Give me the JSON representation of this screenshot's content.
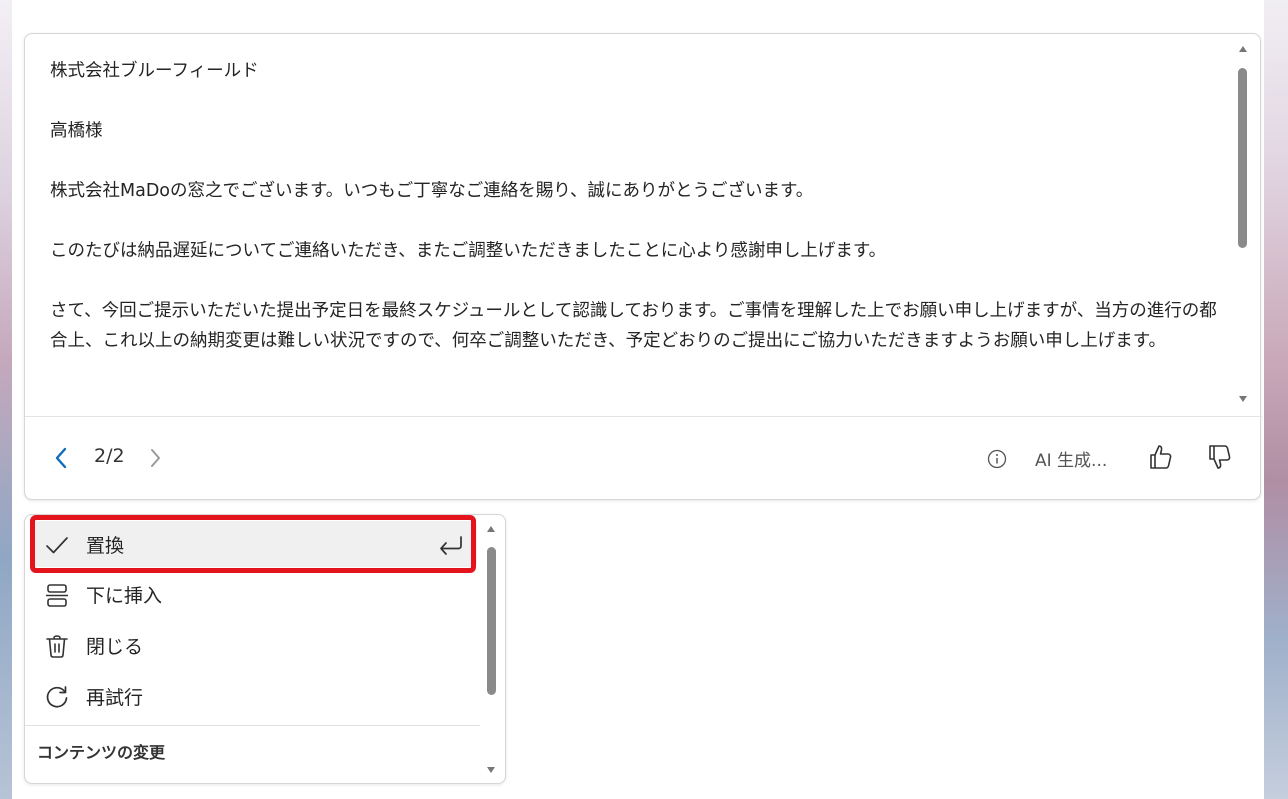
{
  "result": {
    "paragraphs": [
      "株式会社ブルーフィールド",
      "高橋様",
      "株式会社MaDoの窓之でございます。いつもご丁寧なご連絡を賜り、誠にありがとうございます。",
      "このたびは納品遅延についてご連絡いただき、またご調整いただきましたことに心より感謝申し上げます。",
      "さて、今回ご提示いただいた提出予定日を最終スケジュールとして認識しております。ご事情を理解した上でお願い申し上げますが、当方の進行の都合上、これ以上の納期変更は難しい状況ですので、何卒ご調整いただき、予定どおりのご提出にご協力いただきますようお願い申し上げます。"
    ],
    "page_counter": "2/2",
    "ai_label": "AI 生成..."
  },
  "menu": {
    "items": [
      {
        "label": "置換",
        "icon": "checkmark-icon",
        "shortcut_icon": "enter-icon"
      },
      {
        "label": "下に挿入",
        "icon": "insert-below-icon"
      },
      {
        "label": "閉じる",
        "icon": "trash-icon"
      },
      {
        "label": "再試行",
        "icon": "retry-icon"
      }
    ],
    "section_header": "コンテンツの変更"
  },
  "colors": {
    "accent": "#0f6cbd",
    "highlight": "#e3141b"
  }
}
